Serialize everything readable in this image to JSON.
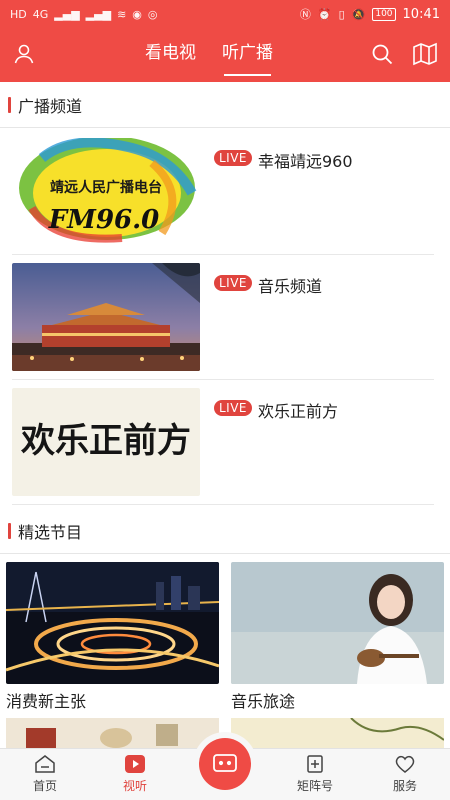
{
  "status": {
    "left_icons": [
      "HD",
      "4G",
      "46",
      "46",
      "wifi",
      "eye",
      "sim"
    ],
    "right_icons": [
      "nfc",
      "alarm",
      "vibrate",
      "mute"
    ],
    "battery": "100",
    "time": "10:41"
  },
  "header": {
    "tabs": [
      {
        "label": "看电视",
        "active": false
      },
      {
        "label": "听广播",
        "active": true
      }
    ]
  },
  "sections": {
    "radio_title": "广播频道",
    "featured_title": "精选节目"
  },
  "channels": [
    {
      "badge": "LIVE",
      "name": "幸福靖远960",
      "logo_line1": "靖远人民广播电台",
      "logo_line2": "FM96.0"
    },
    {
      "badge": "LIVE",
      "name": "音乐频道"
    },
    {
      "badge": "LIVE",
      "name": "欢乐正前方",
      "logo_text": "欢乐正前方"
    }
  ],
  "programs": [
    {
      "title": "消费新主张"
    },
    {
      "title": "音乐旅途"
    }
  ],
  "tabbar": {
    "items": [
      {
        "label": "首页",
        "active": false
      },
      {
        "label": "视听",
        "active": true
      },
      {
        "label": "矩阵号",
        "active": false
      },
      {
        "label": "服务",
        "active": false
      }
    ]
  },
  "colors": {
    "brand": "#ef4b45",
    "accent": "#e0443e"
  }
}
